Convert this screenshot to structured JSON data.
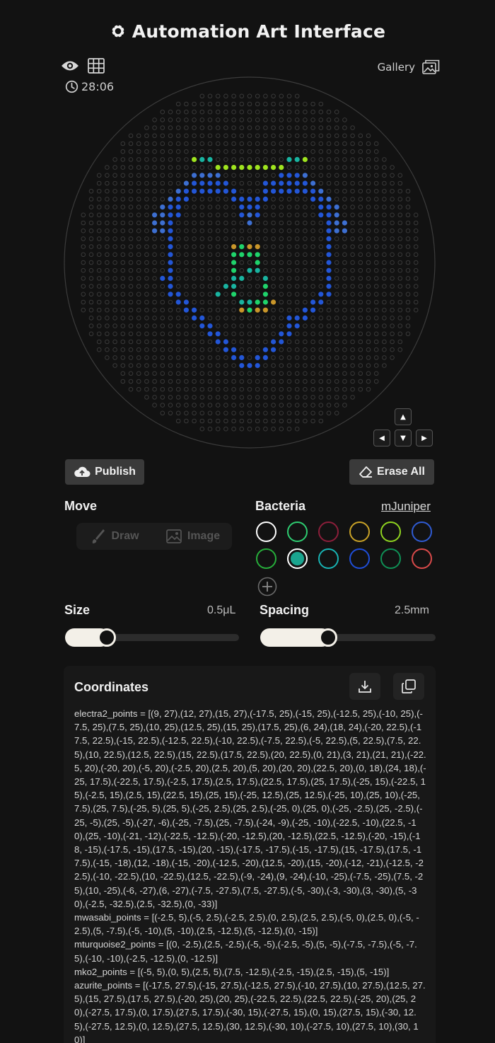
{
  "app": {
    "title": "Automation Art Interface"
  },
  "toolbar": {
    "timer": "28:06",
    "gallery_label": "Gallery"
  },
  "actions": {
    "publish_label": "Publish",
    "erase_label": "Erase All"
  },
  "move": {
    "label": "Move",
    "draw_label": "Draw",
    "image_label": "Image"
  },
  "bacteria": {
    "label": "Bacteria",
    "selected_name": "mJuniper",
    "swatches": [
      {
        "name": "white",
        "color": "#ffffff",
        "selected": false
      },
      {
        "name": "green",
        "color": "#2ecc71",
        "selected": false
      },
      {
        "name": "crimson",
        "color": "#8b1e3a",
        "selected": false
      },
      {
        "name": "gold",
        "color": "#c9a227",
        "selected": false
      },
      {
        "name": "lime",
        "color": "#8fd320",
        "selected": false
      },
      {
        "name": "blue",
        "color": "#2f5bd3",
        "selected": false
      },
      {
        "name": "green2",
        "color": "#27ae3b",
        "selected": false
      },
      {
        "name": "teal",
        "color": "#1aa58f",
        "selected": true
      },
      {
        "name": "turquoise",
        "color": "#18b3b3",
        "selected": false
      },
      {
        "name": "royal-blue",
        "color": "#1f4ed8",
        "selected": false
      },
      {
        "name": "emerald",
        "color": "#0f8f55",
        "selected": false
      },
      {
        "name": "red",
        "color": "#d94a4a",
        "selected": false
      }
    ]
  },
  "size": {
    "label": "Size",
    "value_text": "0.5μL",
    "fraction": 0.12
  },
  "spacing": {
    "label": "Spacing",
    "value_text": "2.5mm",
    "fraction": 0.27
  },
  "coordinates": {
    "title": "Coordinates",
    "blocks": [
      "electra2_points = [(9, 27),(12, 27),(15, 27),(-17.5, 25),(-15, 25),(-12.5, 25),(-10, 25),(-7.5, 25),(7.5, 25),(10, 25),(12.5, 25),(15, 25),(17.5, 25),(6, 24),(18, 24),(-20, 22.5),(-17.5, 22.5),(-15, 22.5),(-12.5, 22.5),(-10, 22.5),(-7.5, 22.5),(-5, 22.5),(5, 22.5),(7.5, 22.5),(10, 22.5),(12.5, 22.5),(15, 22.5),(17.5, 22.5),(20, 22.5),(0, 21),(3, 21),(21, 21),(-22.5, 20),(-20, 20),(-5, 20),(-2.5, 20),(2.5, 20),(5, 20),(20, 20),(22.5, 20),(0, 18),(24, 18),(-25, 17.5),(-22.5, 17.5),(-2.5, 17.5),(2.5, 17.5),(22.5, 17.5),(25, 17.5),(-25, 15),(-22.5, 15),(-2.5, 15),(2.5, 15),(22.5, 15),(25, 15),(-25, 12.5),(25, 12.5),(-25, 10),(25, 10),(-25, 7.5),(25, 7.5),(-25, 5),(25, 5),(-25, 2.5),(25, 2.5),(-25, 0),(25, 0),(-25, -2.5),(25, -2.5),(-25, -5),(25, -5),(-27, -6),(-25, -7.5),(25, -7.5),(-24, -9),(-25, -10),(-22.5, -10),(22.5, -10),(25, -10),(-21, -12),(-22.5, -12.5),(-20, -12.5),(20, -12.5),(22.5, -12.5),(-20, -15),(-18, -15),(-17.5, -15),(17.5, -15),(20, -15),(-17.5, -17.5),(-15, -17.5),(15, -17.5),(17.5, -17.5),(-15, -18),(12, -18),(-15, -20),(-12.5, -20),(12.5, -20),(15, -20),(-12, -21),(-12.5, -22.5),(-10, -22.5),(10, -22.5),(12.5, -22.5),(-9, -24),(9, -24),(-10, -25),(-7.5, -25),(7.5, -25),(10, -25),(-6, -27),(6, -27),(-7.5, -27.5),(7.5, -27.5),(-5, -30),(-3, -30),(3, -30),(5, -30),(-2.5, -32.5),(2.5, -32.5),(0, -33)]",
      "mwasabi_points = [(-2.5, 5),(-5, 2.5),(-2.5, 2.5),(0, 2.5),(2.5, 2.5),(-5, 0),(2.5, 0),(-5, -2.5),(5, -7.5),(-5, -10),(5, -10),(2.5, -12.5),(5, -12.5),(0, -15)]",
      "mturquoise2_points = [(0, -2.5),(2.5, -2.5),(-5, -5),(-2.5, -5),(5, -5),(-7.5, -7.5),(-5, -7.5),(-10, -10),(-2.5, -12.5),(0, -12.5)]",
      "mko2_points = [(-5, 5),(0, 5),(2.5, 5),(7.5, -12.5),(-2.5, -15),(2.5, -15),(5, -15)]",
      "azurite_points = [(-17.5, 27.5),(-15, 27.5),(-12.5, 27.5),(-10, 27.5),(10, 27.5),(12.5, 27.5),(15, 27.5),(17.5, 27.5),(-20, 25),(20, 25),(-22.5, 22.5),(22.5, 22.5),(-25, 20),(25, 20),(-27.5, 17.5),(0, 17.5),(27.5, 17.5),(-30, 15),(-27.5, 15),(0, 15),(27.5, 15),(-30, 12.5),(-27.5, 12.5),(0, 12.5),(27.5, 12.5),(30, 12.5),(-30, 10),(-27.5, 10),(27.5, 10),(30, 10)]"
    ]
  },
  "colors": {
    "electra": "#2356d6",
    "electra_alt": "#3d6fd1",
    "mwasabi": "#1fd36b",
    "mwasabi_alt": "#11a457",
    "mturquoise": "#19b3a0",
    "mko": "#c9962a",
    "lime": "#9fe41f",
    "empty": "#3a3a3a"
  }
}
